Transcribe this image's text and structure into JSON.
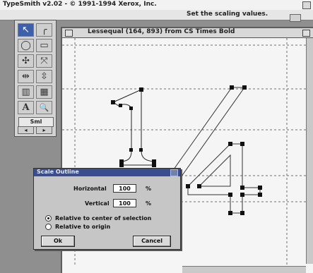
{
  "app": {
    "title": "TypeSmith v2.02 - © 1991-1994 Xerox, Inc."
  },
  "status": {
    "message": "Set the scaling values."
  },
  "glyph_window": {
    "title": "Lessequal (164, 893) from CS Times Bold"
  },
  "palette": {
    "tools": [
      {
        "name": "pointer-tool-icon",
        "glyph": "↖",
        "selected": true
      },
      {
        "name": "pen-tool-icon",
        "glyph": "╭",
        "selected": false
      },
      {
        "name": "ellipse-tool-icon",
        "glyph": "◯",
        "selected": false
      },
      {
        "name": "rectangle-tool-icon",
        "glyph": "▭",
        "selected": false
      },
      {
        "name": "rotate-tool-icon",
        "glyph": "✣",
        "selected": false
      },
      {
        "name": "scale-tool-icon",
        "glyph": "⤧",
        "selected": false
      },
      {
        "name": "flip-horizontal-tool-icon",
        "glyph": "⇹",
        "selected": false
      },
      {
        "name": "flip-vertical-tool-icon",
        "glyph": "⇳",
        "selected": false
      },
      {
        "name": "skew-tool-icon",
        "glyph": "▥",
        "selected": false
      },
      {
        "name": "mirror-tool-icon",
        "glyph": "▦",
        "selected": false
      },
      {
        "name": "text-tool-icon",
        "glyph": "A",
        "selected": false
      },
      {
        "name": "magnify-tool-icon",
        "glyph": "🔍",
        "selected": false
      }
    ],
    "label": "Sml",
    "arrows": [
      "◂",
      "▸"
    ]
  },
  "dialog": {
    "title": "Scale Outline",
    "horizontal_label": "Horizontal",
    "horizontal_value": "100",
    "horizontal_unit": "%",
    "vertical_label": "Vertical",
    "vertical_value": "100",
    "vertical_unit": "%",
    "option_center": "Relative to center of selection",
    "option_origin": "Relative to origin",
    "selected_option": "center",
    "ok_label": "Ok",
    "cancel_label": "Cancel"
  },
  "colors": {
    "selection_blue": "#3f5fa8",
    "dialog_title": "#3a4d8f",
    "guide_line": "#777777"
  }
}
